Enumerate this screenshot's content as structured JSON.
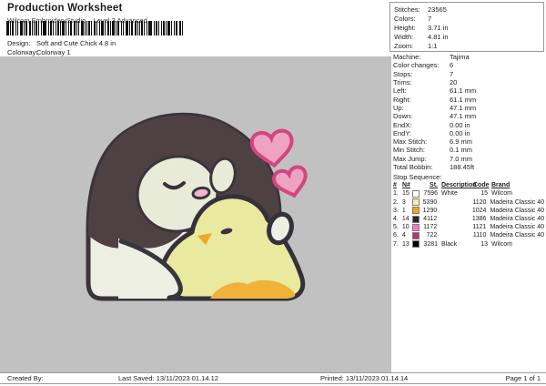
{
  "header": {
    "title": "Production Worksheet",
    "subtitle": "Wilcom EmbroideryStudio – Level 3 Advanced",
    "design_label": "Design:",
    "design_value": "Soft and Cute Chick 4.8 in",
    "colorway_label": "Colorway:",
    "colorway_value": "Colorway 1"
  },
  "summary": {
    "rows": [
      {
        "label": "Stitches:",
        "value": "23565"
      },
      {
        "label": "Colors:",
        "value": "7"
      },
      {
        "label": "Height:",
        "value": "3.71 in"
      },
      {
        "label": "Width:",
        "value": "4.81 in"
      },
      {
        "label": "Zoom:",
        "value": "1:1"
      }
    ]
  },
  "machine_info": {
    "rows": [
      {
        "label": "Machine:",
        "value": "Tajima"
      },
      {
        "label": "Color changes:",
        "value": "6"
      },
      {
        "label": "Stops:",
        "value": "7"
      },
      {
        "label": "Trims:",
        "value": "20"
      },
      {
        "label": "Left:",
        "value": "61.1 mm"
      },
      {
        "label": "Right:",
        "value": "61.1 mm"
      },
      {
        "label": "Up:",
        "value": "47.1 mm"
      },
      {
        "label": "Down:",
        "value": "47.1 mm"
      },
      {
        "label": "EndX:",
        "value": "0.00 in"
      },
      {
        "label": "EndY:",
        "value": "0.00 in"
      },
      {
        "label": "Max Stitch:",
        "value": "6.9 mm"
      },
      {
        "label": "Min Stitch:",
        "value": "0.1 mm"
      },
      {
        "label": "Max Jump:",
        "value": "7.0 mm"
      },
      {
        "label": "Total Bobbin:",
        "value": "188.45ft"
      }
    ]
  },
  "stop_sequence": {
    "title": "Stop Sequence:",
    "headers": {
      "num": "#",
      "n": "N#",
      "st": "St.",
      "description": "Description",
      "code": "Code",
      "brand": "Brand"
    },
    "rows": [
      {
        "num": "1.",
        "n": "15",
        "swatch": "#FFFFFF",
        "st": "7596",
        "description": "White",
        "code": "15",
        "brand": "Wilcom"
      },
      {
        "num": "2.",
        "n": "3",
        "swatch": "#F4F0A4",
        "st": "5390",
        "description": "",
        "code": "1120",
        "brand": "Madeira Classic 40"
      },
      {
        "num": "3.",
        "n": "1",
        "swatch": "#F2A41F",
        "st": "1290",
        "description": "",
        "code": "1024",
        "brand": "Madeira Classic 40"
      },
      {
        "num": "4.",
        "n": "14",
        "swatch": "#2E2327",
        "st": "4112",
        "description": "",
        "code": "1386",
        "brand": "Madeira Classic 40"
      },
      {
        "num": "5.",
        "n": "10",
        "swatch": "#F07FC0",
        "st": "1172",
        "description": "",
        "code": "1121",
        "brand": "Madeira Classic 40"
      },
      {
        "num": "6.",
        "n": "4",
        "swatch": "#C02F66",
        "st": "722",
        "description": "",
        "code": "1110",
        "brand": "Madeira Classic 40"
      },
      {
        "num": "7.",
        "n": "13",
        "swatch": "#000000",
        "st": "3281",
        "description": "Black",
        "code": "13",
        "brand": "Wilcom"
      }
    ]
  },
  "footer": {
    "created_by": "Created By:",
    "last_saved": "Last Saved: 13/11/2023 01.14.12",
    "printed": "Printed: 13/11/2023 01.14.14",
    "page": "Page 1 of 1"
  },
  "design_preview": {
    "description": "Penguin hugging a chick embroidery design with two hearts",
    "colors": {
      "canvas_bg": "#C1C1C1",
      "penguin_dark": "#4E4144",
      "penguin_body": "#EDEFE2",
      "face_patch": "#E8EBD8",
      "outline": "#3A343B",
      "chick_yellow": "#E9E9A0",
      "chick_orange": "#F0B23B",
      "beak_orange": "#EFA726",
      "beak_pink": "#F2B5CC",
      "heart_fill": "#EFA3C2",
      "heart_stroke": "#D4457F"
    }
  }
}
